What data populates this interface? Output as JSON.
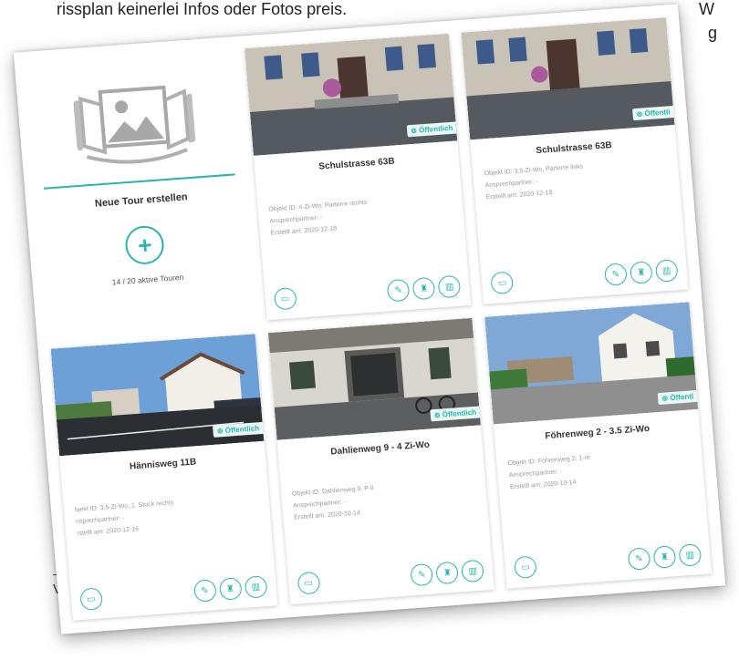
{
  "page": {
    "top_left_text": "rissplan keinerlei Infos oder Fotos preis.",
    "top_right_text_1": "W",
    "top_right_text_2": "g",
    "low_left_text": "V"
  },
  "new_tour": {
    "title": "Neue Tour erstellen",
    "plus": "+",
    "count": "14 / 20 aktive Touren"
  },
  "tours": [
    {
      "title": "Schulstrasse 63B",
      "badge": "Öffentlich",
      "objekt": "Objekt ID: 4-Zi-Wo, Parterre rechts",
      "contact": "Ansprechpartner: -",
      "created": "Erstellt am: 2020-12-18"
    },
    {
      "title": "Schulstrasse 63B",
      "badge": "Öffentli",
      "objekt": "Objekt ID: 3.5-Zi-Wo, Parterre links",
      "contact": "Ansprechpartner: -",
      "created": "Erstellt am: 2020-12-18"
    },
    {
      "title": "Hännisweg 11B",
      "badge": "Öffentlich",
      "objekt": "bjekt ID: 3.5-Zi-Wo, 1. Stock rechts",
      "contact": "nsprechpartner: -",
      "created": "rstellt am: 2020-12-16"
    },
    {
      "title": "Dahlienweg 9 - 4 Zi-Wo",
      "badge": "Öffentlich",
      "objekt": "Objekt ID: Dahlienweg 9; P-li",
      "contact": "Ansprechpartner: -",
      "created": "Erstellt am: 2020-10-14"
    },
    {
      "title": "Föhrenweg 2 - 3.5 Zi-Wo",
      "badge": "Öffentl",
      "objekt": "Objekt ID: Föhrenweg 2; 1-re",
      "contact": "Ansprechpartner: -",
      "created": "Erstellt am: 2020-10-14"
    }
  ],
  "icons": {
    "monitor": "monitor-icon",
    "edit": "pencil-icon",
    "podium": "podium-icon",
    "stats": "bar-chart-icon"
  },
  "colors": {
    "accent": "#2bb5ad",
    "badge_bg": "#e9f7f5"
  }
}
